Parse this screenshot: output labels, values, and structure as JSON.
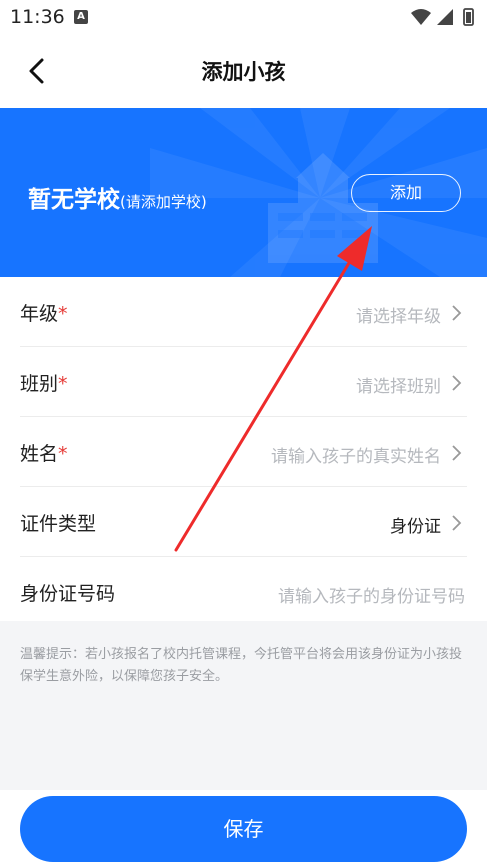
{
  "status_bar": {
    "time": "11:36",
    "badge": "A"
  },
  "header": {
    "title": "添加小孩"
  },
  "school": {
    "name": "暂无学校",
    "hint": "(请添加学校)",
    "add_label": "添加"
  },
  "form": {
    "grade": {
      "label": "年级",
      "required_mark": "*",
      "placeholder": "请选择年级"
    },
    "class": {
      "label": "班别",
      "required_mark": "*",
      "placeholder": "请选择班别"
    },
    "name": {
      "label": "姓名",
      "required_mark": "*",
      "placeholder": "请输入孩子的真实姓名"
    },
    "id_type": {
      "label": "证件类型",
      "value": "身份证"
    },
    "id_number": {
      "label": "身份证号码",
      "placeholder": "请输入孩子的身份证号码"
    }
  },
  "tip": "温馨提示：若小孩报名了校内托管课程，今托管平台将会用该身份证为小孩投保学生意外险，以保障您孩子安全。",
  "footer": {
    "save_label": "保存"
  },
  "colors": {
    "primary": "#1774ff",
    "required": "#e53935",
    "annotation_arrow": "#ee2b2b"
  }
}
